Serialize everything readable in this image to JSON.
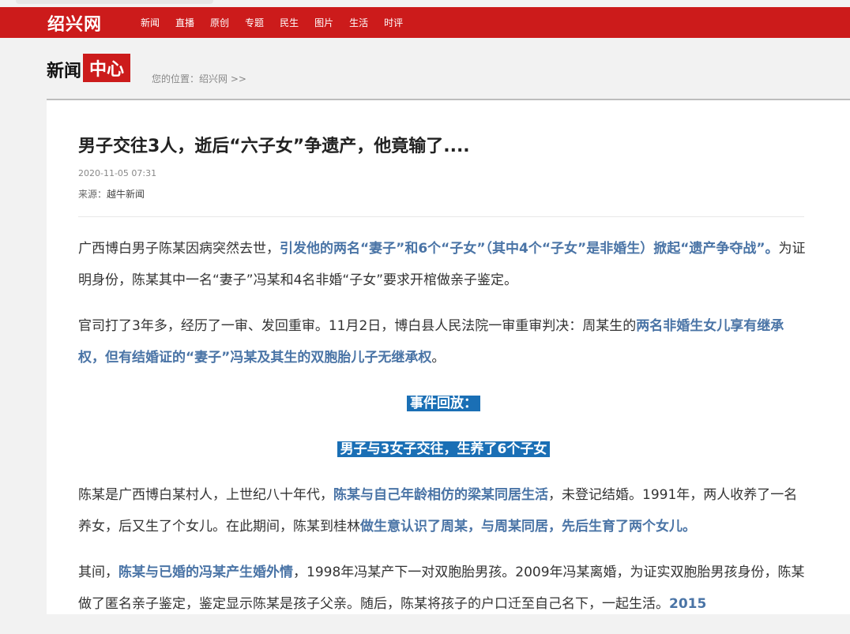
{
  "site": {
    "logo": "绍兴网",
    "nav": [
      "新闻",
      "直播",
      "原创",
      "专题",
      "民生",
      "图片",
      "生活",
      "时评"
    ]
  },
  "header": {
    "brand_part1": "新闻",
    "brand_part2": "中心",
    "breadcrumb_prefix": "您的位置：",
    "breadcrumb_link": "绍兴网",
    "breadcrumb_sep": " >>"
  },
  "article": {
    "title": "男子交往3人，逝后“六子女”争遗产，他竟输了....",
    "date": "2020-11-05 07:31",
    "source_label": "来源：",
    "source_value": "越牛新闻",
    "p1": [
      "广西博白男子陈某因病突然去世，",
      "引发他的两名“妻子”和6个“子女”（其中4个“子女”是非婚生）掀起“遗产争夺战”。",
      "为证明身份，陈某其中一名“妻子”冯某和4名非婚“子女”要求开棺做亲子鉴定。"
    ],
    "p2": [
      "官司打了3年多，经历了一审、发回重审。11月2日，博白县人民法院一审重审判决：周某生的",
      "两名非婚生女儿享有继承权，但有结婚证的“妻子”冯某及其生的双胞胎儿子无继承权",
      "。"
    ],
    "section1": "事件回放：",
    "section2": "男子与3女子交往，生养了6个子女",
    "p3": [
      "陈某是广西博白某村人，上世纪八十年代，",
      "陈某与自己年龄相仿的梁某同居生活",
      "，未登记结婚。1991年，两人收养了一名养女，后又生了个女儿。在此期间，陈某到桂林",
      "做生意认识了周某，与周某同居，先后生育了两个女儿。"
    ],
    "p4": [
      "其间，",
      "陈某与已婚的冯某产生婚外情",
      "，1998年冯某产下一对双胞胎男孩。2009年冯某离婚，为证实双胞胎男孩身份，陈某做了匿名亲子鉴定，鉴定显示陈某是孩子父亲。随后，陈某将孩子的户口迁至自己名下，一起生活。",
      "2015"
    ]
  },
  "colors": {
    "brand_red": "#cc1b1b",
    "highlight_blue": "#4a74a6",
    "tag_blue": "#1a6fb5"
  }
}
